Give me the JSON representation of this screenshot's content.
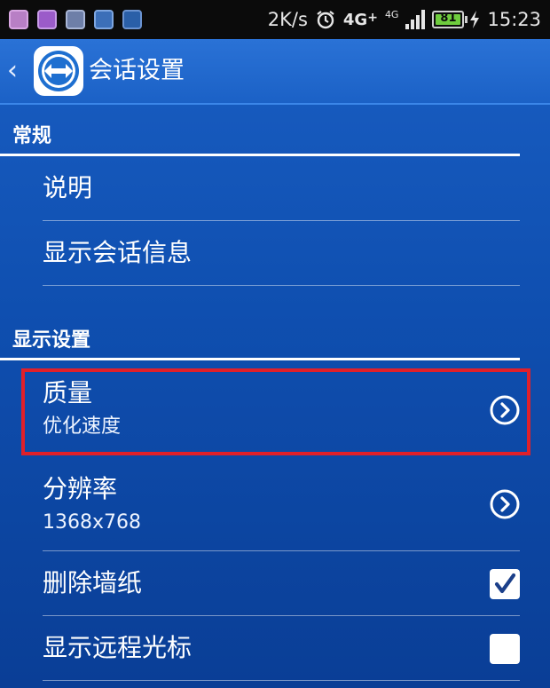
{
  "status_bar": {
    "net_speed": "2K/s",
    "network": "4G",
    "network_sub": "4G",
    "battery": "81",
    "time": "15:23"
  },
  "action_bar": {
    "title": "会话设置"
  },
  "sections": {
    "general": {
      "header": "常规",
      "items": [
        "说明",
        "显示会话信息"
      ]
    },
    "display": {
      "header": "显示设置",
      "quality": {
        "title": "质量",
        "value": "优化速度"
      },
      "resolution": {
        "title": "分辨率",
        "value": "1368x768"
      },
      "remove_wallpaper": {
        "title": "删除墙纸",
        "checked": true
      },
      "show_remote_cursor": {
        "title": "显示远程光标",
        "checked": false
      }
    }
  },
  "colors": {
    "background": "#0f4fb0",
    "highlight_border": "#e0202a",
    "battery_fill": "#6fcc3e"
  },
  "icons": [
    "back-chevron-icon",
    "teamviewer-logo-icon",
    "chevron-right-circle-icon",
    "check-icon",
    "alarm-icon",
    "signal-icon",
    "battery-icon",
    "charging-icon"
  ]
}
